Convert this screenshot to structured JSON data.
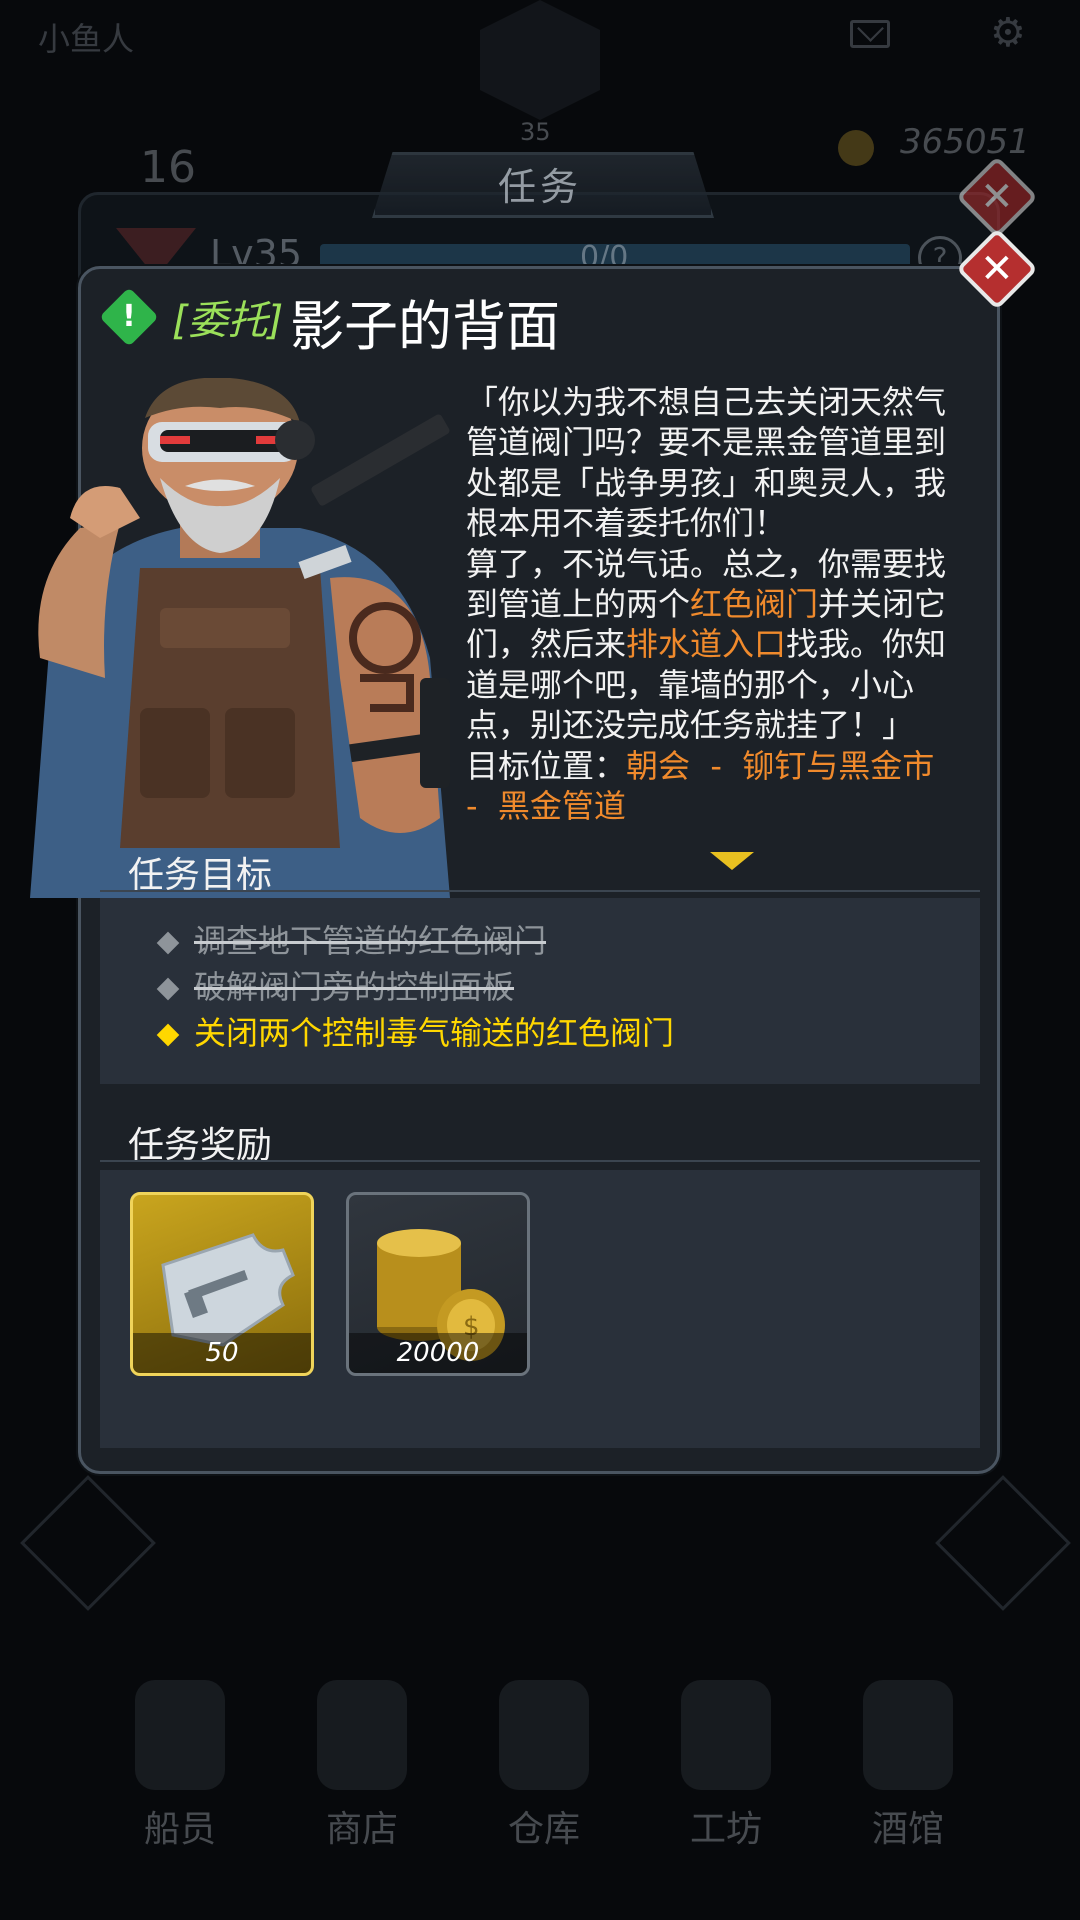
{
  "background": {
    "player_name": "小鱼人",
    "player_level": "35",
    "energy": "16",
    "gold": "365051",
    "panel_title": "任务",
    "level_label": "Lv35",
    "progress": "0/0",
    "help": "?",
    "nav": [
      {
        "label": "船员"
      },
      {
        "label": "商店"
      },
      {
        "label": "仓库"
      },
      {
        "label": "工坊"
      },
      {
        "label": "酒馆"
      }
    ]
  },
  "quest": {
    "tag": "[委托]",
    "title": "影子的背面",
    "alert": "!",
    "story_lines": [
      "「你以为我不想自己去关闭天然气",
      "管道阀门吗？要不是黑金管道里到",
      "处都是「战争男孩」和奥灵人，我",
      "根本用不着委托你们！",
      "算了，不说气话。总之，你需要找"
    ],
    "story_line6": {
      "pre": "到管道上的两个",
      "hl": "红色阀门",
      "post": "并关闭它"
    },
    "story_line7": {
      "pre": "们，然后来",
      "hl": "排水道入口",
      "post": "找我。你知"
    },
    "story_tail": [
      "道是哪个吧，靠墙的那个，小心",
      "点，别还没完成任务就挂了！」"
    ],
    "location_label": "目标位置：",
    "location_part1": "朝会  -  铆钉与黑金市",
    "location_part2": "-  黑金管道",
    "objectives_title": "任务目标",
    "objectives": [
      {
        "text": "调查地下管道的红色阀门",
        "status": "completed"
      },
      {
        "text": "破解阀门旁的控制面板",
        "status": "completed"
      },
      {
        "text": "关闭两个控制毒气输送的红色阀门",
        "status": "active"
      }
    ],
    "rewards_title": "任务奖励",
    "rewards": [
      {
        "icon": "weapon-blueprint-icon",
        "amount": "50"
      },
      {
        "icon": "gold-coins-icon",
        "amount": "20000"
      }
    ]
  },
  "colors": {
    "highlight": "#f08a2c",
    "active_objective": "#ffd700",
    "tag": "#9be05a",
    "close": "#b52f2f"
  }
}
